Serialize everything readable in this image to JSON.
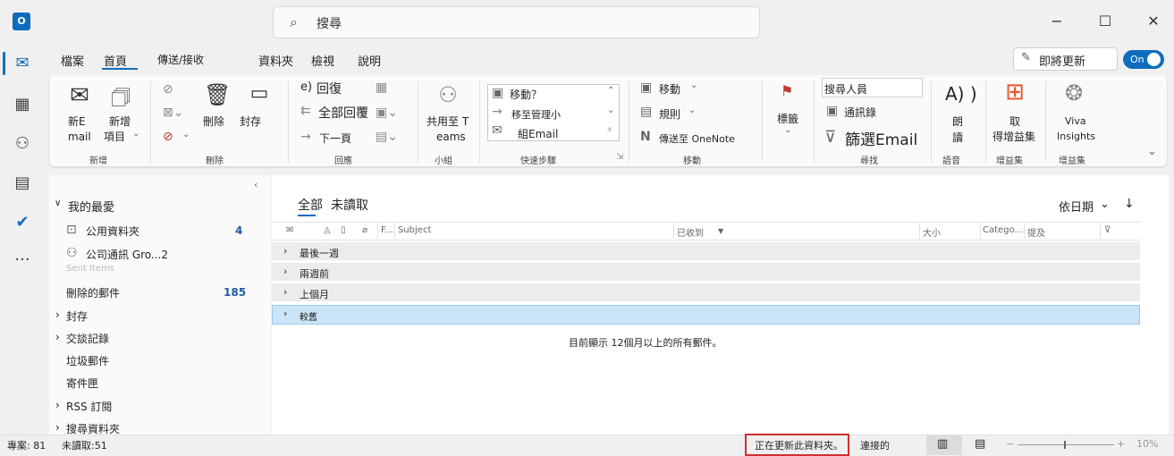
{
  "app": {
    "logo": "O",
    "search_placeholder": "搜尋",
    "window_controls": [
      "−",
      "☐",
      "✕"
    ]
  },
  "tabs": [
    "檔案",
    "首頁",
    "傳送/接收",
    "資料夾",
    "檢視",
    "說明"
  ],
  "toggle": {
    "label": "即將更新",
    "state": "On"
  },
  "ribbon": {
    "new": {
      "new_email": [
        "新E",
        "mail"
      ],
      "new_item": [
        "新增",
        "項目"
      ],
      "group_label": "新增"
    },
    "delete": {
      "delete_label": "刪除",
      "archive_label": "封存",
      "group_label": "刪除"
    },
    "respond": {
      "reply": "回復",
      "reply_prefix": "e)",
      "reply_all": "全部回覆",
      "forward": "下一頁",
      "group_label": "回應"
    },
    "teams": {
      "label": [
        "共用至 T",
        "eams"
      ],
      "group_label": "小組"
    },
    "quicksteps": {
      "items": [
        "移動？",
        "移至管理小",
        "組Email"
      ],
      "group_label": "快速步驟"
    },
    "move": {
      "move": "移動",
      "rules": "規則",
      "onenote": "傳送至 OneNote",
      "group_label": "移動"
    },
    "tags": {
      "label": "標籤"
    },
    "find": {
      "search_people": "搜尋人員",
      "address_book": "通訊錄",
      "filter_email": "篩選Email",
      "group_label": "尋找"
    },
    "speech": {
      "icon_text": "A) )",
      "label": [
        "朗",
        "讀"
      ],
      "group_label": "語音"
    },
    "addins": {
      "label": [
        "取",
        "得增益集"
      ],
      "group_label": "增益集"
    },
    "viva": {
      "label": [
        "Viva",
        "Insights"
      ],
      "group_label": "增益集"
    }
  },
  "folders": {
    "favorites_header": "我的最愛",
    "items": [
      {
        "label": "公用資料夾",
        "count": "4"
      },
      {
        "label": "公司通訊 Gro...2",
        "count": ""
      },
      {
        "label": "刪除的郵件",
        "count": "185"
      },
      {
        "label": "封存",
        "count": ""
      },
      {
        "label": "交談記錄",
        "count": ""
      },
      {
        "label": "垃圾郵件",
        "count": ""
      },
      {
        "label": "寄件匣",
        "count": ""
      },
      {
        "label": "RSS 訂閱",
        "count": ""
      },
      {
        "label": "搜尋資料夾",
        "count": ""
      }
    ],
    "ghost_label": "Sent Items"
  },
  "msglist": {
    "filter_all": "全部",
    "filter_unread": "未讀取",
    "sort_label": "依日期",
    "columns": {
      "flag_f": "F...",
      "subject": "Subject",
      "received": "已收到",
      "size": "大小",
      "categories": "Catego...",
      "mention": "提及"
    },
    "groups": [
      "最後一週",
      "兩週前",
      "上個月",
      "較舊"
    ],
    "footer_note": "目前顯示 12個月以上的所有郵件。"
  },
  "status": {
    "items": "專案: 81",
    "unread": "未讀取:51",
    "updating": "正在更新此資料夾。",
    "connected": "連接的",
    "zoom": "10%"
  }
}
